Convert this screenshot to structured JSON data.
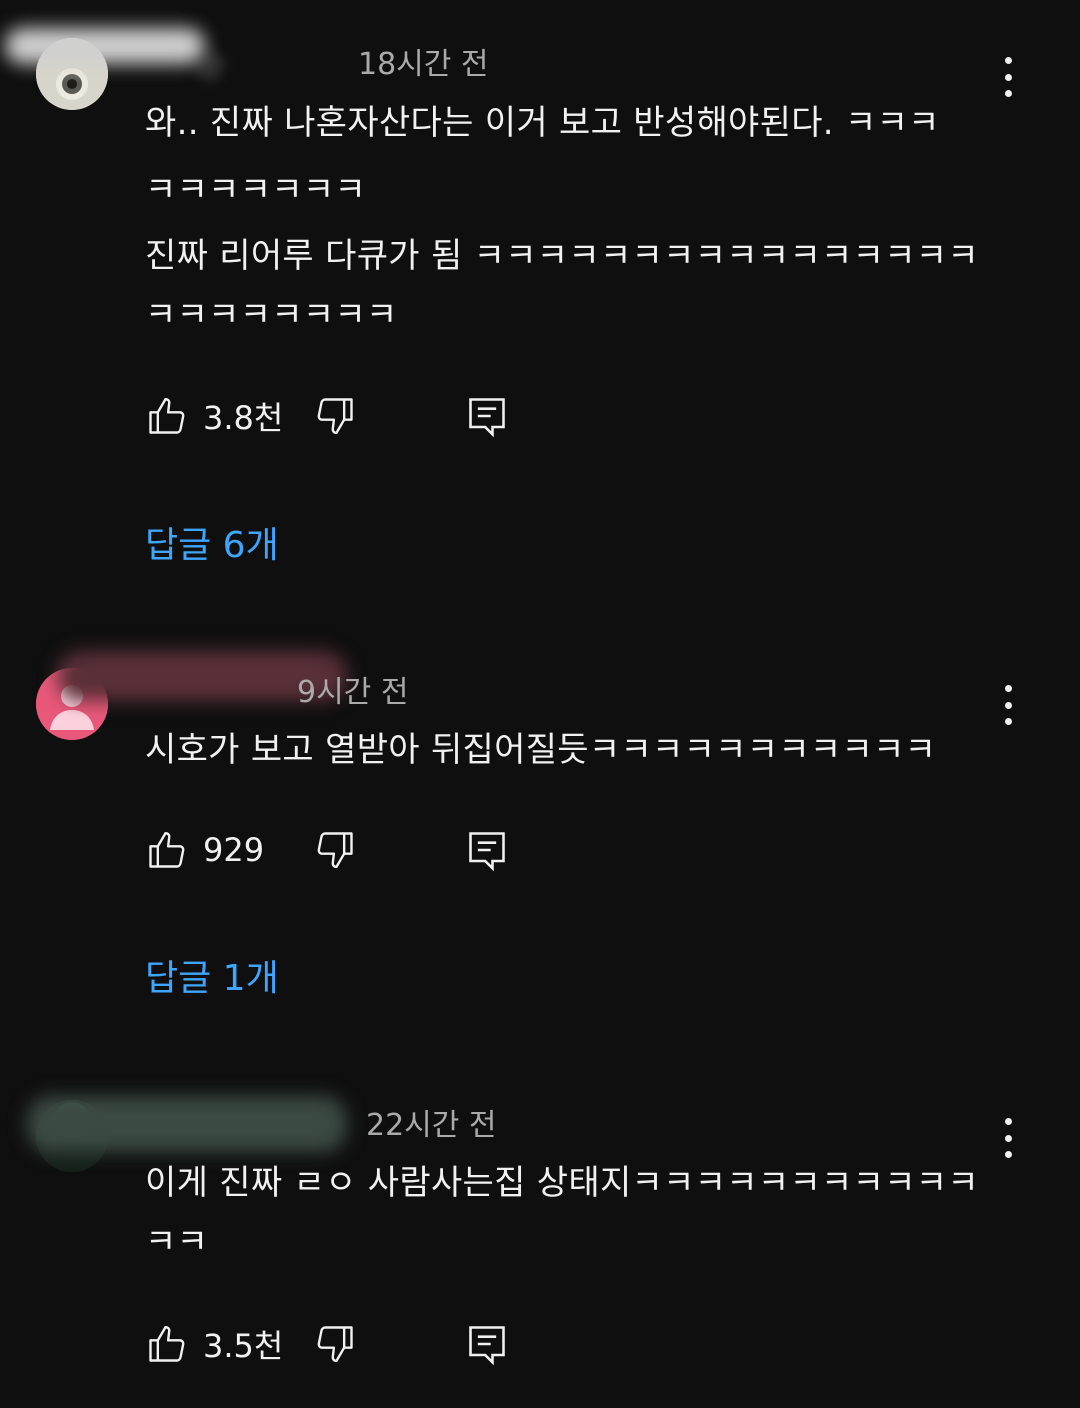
{
  "colors": {
    "background": "#0f0f0f",
    "text": "#f1f1f1",
    "secondary_text": "#aaaaaa",
    "link": "#3ea6ff"
  },
  "comments": [
    {
      "author": "@",
      "time": "18시간 전",
      "lines": [
        "와.. 진짜 나혼자산다는 이거 보고 반성해야된다. ㅋㅋㅋ",
        "ㅋㅋㅋㅋㅋㅋㅋ",
        "진짜 리어루 다큐가 됨 ㅋㅋㅋㅋㅋㅋㅋㅋㅋㅋㅋㅋㅋㅋㅋㅋ",
        "ㅋㅋㅋㅋㅋㅋㅋㅋ"
      ],
      "likes": "3.8천",
      "replies": "답글 6개",
      "avatar_icon": "camera-lens-avatar-icon"
    },
    {
      "author": "",
      "time": "9시간 전",
      "lines": [
        "시호가 보고 열받아 뒤집어질듯ㅋㅋㅋㅋㅋㅋㅋㅋㅋㅋㅋ"
      ],
      "likes": "929",
      "replies": "답글 1개",
      "avatar_icon": "default-person-avatar-icon"
    },
    {
      "author": "",
      "time": "22시간 전",
      "lines": [
        "이게 진짜 ㄹㅇ 사람사는집 상태지ㅋㅋㅋㅋㅋㅋㅋㅋㅋㅋㅋ",
        "ㅋㅋ"
      ],
      "likes": "3.5천",
      "avatar_icon": "landscape-avatar-icon"
    }
  ]
}
